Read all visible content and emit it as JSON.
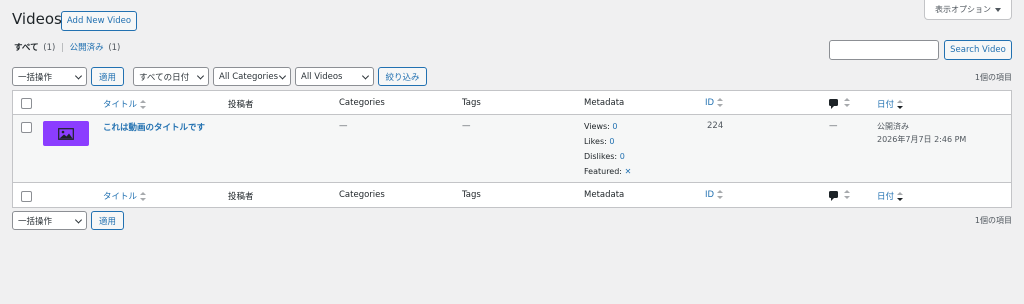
{
  "page": {
    "title": "Videos",
    "add_new_label": "Add New Video",
    "screen_options_label": "表示オプション"
  },
  "filters": {
    "all_label": "すべて",
    "all_count": "(1)",
    "separator": "|",
    "published_label": "公開済み",
    "published_count": "(1)"
  },
  "search": {
    "value": "",
    "button_label": "Search Video"
  },
  "tablenav_top": {
    "bulk_action": "一括操作",
    "apply_label": "適用",
    "date_filter": "すべての日付",
    "category_filter": "All Categories",
    "video_filter": "All Videos",
    "filter_button": "絞り込み",
    "item_count": "1個の項目"
  },
  "table": {
    "columns": {
      "title": "タイトル",
      "author": "投稿者",
      "categories": "Categories",
      "tags": "Tags",
      "metadata": "Metadata",
      "id": "ID",
      "date": "日付"
    },
    "rows": [
      {
        "title": "これは動画のタイトルです",
        "author": "",
        "categories": "—",
        "tags": "—",
        "metadata": {
          "views_label": "Views:",
          "views_value": "0",
          "likes_label": "Likes:",
          "likes_value": "0",
          "dislikes_label": "Dislikes:",
          "dislikes_value": "0",
          "featured_label": "Featured:",
          "featured_value": "✕"
        },
        "id": "224",
        "comments": "—",
        "status": "公開済み",
        "date": "2026年7月7日 2:46 PM"
      }
    ]
  },
  "tablenav_bottom": {
    "bulk_action": "一括操作",
    "apply_label": "適用",
    "item_count": "1個の項目"
  },
  "colors": {
    "accent": "#2271b1",
    "thumbnail": "#8b3dff",
    "background": "#f0f0f1"
  }
}
